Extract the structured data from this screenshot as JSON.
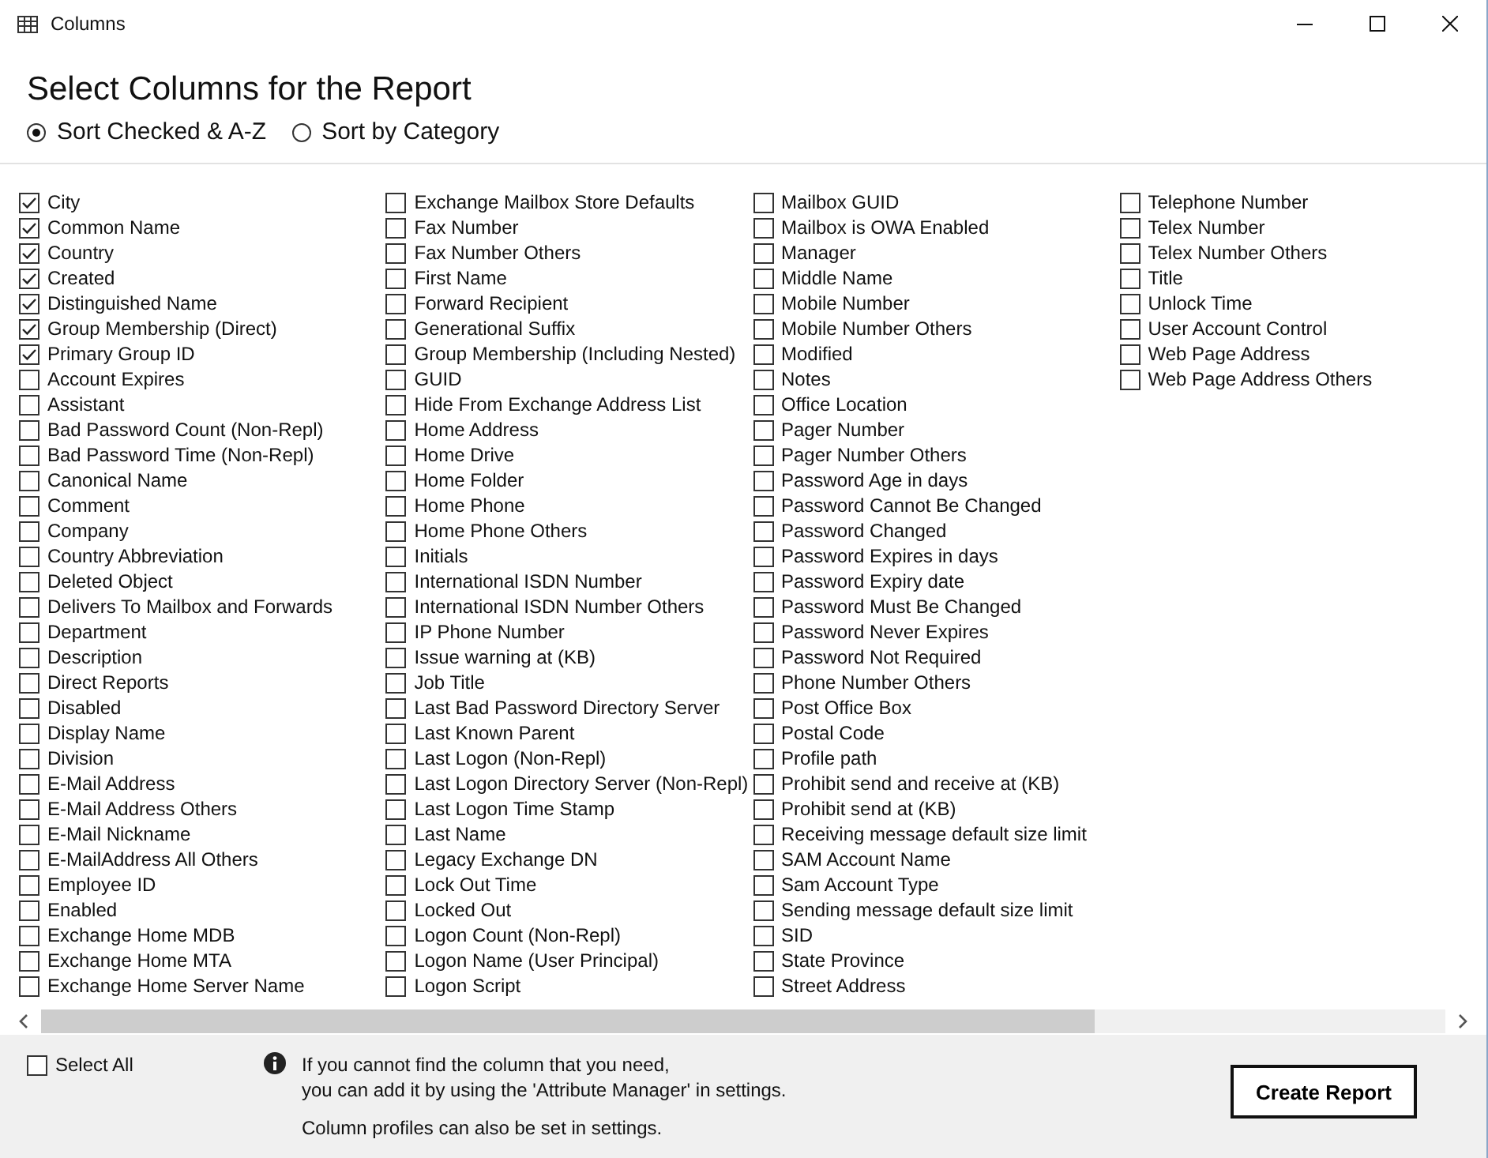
{
  "window": {
    "title": "Columns"
  },
  "heading": "Select Columns for the Report",
  "sort_options": [
    {
      "label": "Sort Checked & A-Z",
      "selected": true
    },
    {
      "label": "Sort by Category",
      "selected": false
    }
  ],
  "columns": [
    [
      {
        "label": "City",
        "checked": true
      },
      {
        "label": "Common Name",
        "checked": true
      },
      {
        "label": "Country",
        "checked": true
      },
      {
        "label": "Created",
        "checked": true
      },
      {
        "label": "Distinguished Name",
        "checked": true
      },
      {
        "label": "Group Membership (Direct)",
        "checked": true
      },
      {
        "label": "Primary Group ID",
        "checked": true
      },
      {
        "label": "Account Expires",
        "checked": false
      },
      {
        "label": "Assistant",
        "checked": false
      },
      {
        "label": "Bad Password Count (Non-Repl)",
        "checked": false
      },
      {
        "label": "Bad Password Time (Non-Repl)",
        "checked": false
      },
      {
        "label": "Canonical Name",
        "checked": false
      },
      {
        "label": "Comment",
        "checked": false
      },
      {
        "label": "Company",
        "checked": false
      },
      {
        "label": "Country Abbreviation",
        "checked": false
      },
      {
        "label": "Deleted Object",
        "checked": false
      },
      {
        "label": "Delivers To Mailbox and Forwards",
        "checked": false
      },
      {
        "label": "Department",
        "checked": false
      },
      {
        "label": "Description",
        "checked": false
      },
      {
        "label": "Direct Reports",
        "checked": false
      },
      {
        "label": "Disabled",
        "checked": false
      },
      {
        "label": "Display Name",
        "checked": false
      },
      {
        "label": "Division",
        "checked": false
      },
      {
        "label": "E-Mail Address",
        "checked": false
      },
      {
        "label": "E-Mail Address Others",
        "checked": false
      },
      {
        "label": "E-Mail Nickname",
        "checked": false
      },
      {
        "label": "E-MailAddress All Others",
        "checked": false
      },
      {
        "label": "Employee ID",
        "checked": false
      },
      {
        "label": "Enabled",
        "checked": false
      },
      {
        "label": "Exchange Home MDB",
        "checked": false
      },
      {
        "label": "Exchange Home MTA",
        "checked": false
      },
      {
        "label": "Exchange Home Server Name",
        "checked": false
      }
    ],
    [
      {
        "label": "Exchange Mailbox Store Defaults",
        "checked": false
      },
      {
        "label": "Fax Number",
        "checked": false
      },
      {
        "label": "Fax Number Others",
        "checked": false
      },
      {
        "label": "First Name",
        "checked": false
      },
      {
        "label": "Forward Recipient",
        "checked": false
      },
      {
        "label": "Generational Suffix",
        "checked": false
      },
      {
        "label": "Group Membership (Including Nested)",
        "checked": false
      },
      {
        "label": "GUID",
        "checked": false
      },
      {
        "label": "Hide From Exchange Address List",
        "checked": false
      },
      {
        "label": "Home Address",
        "checked": false
      },
      {
        "label": "Home Drive",
        "checked": false
      },
      {
        "label": "Home Folder",
        "checked": false
      },
      {
        "label": "Home Phone",
        "checked": false
      },
      {
        "label": "Home Phone Others",
        "checked": false
      },
      {
        "label": "Initials",
        "checked": false
      },
      {
        "label": "International ISDN Number",
        "checked": false
      },
      {
        "label": "International ISDN Number Others",
        "checked": false
      },
      {
        "label": "IP Phone Number",
        "checked": false
      },
      {
        "label": "Issue warning at (KB)",
        "checked": false
      },
      {
        "label": "Job Title",
        "checked": false
      },
      {
        "label": "Last Bad Password Directory Server",
        "checked": false
      },
      {
        "label": "Last Known Parent",
        "checked": false
      },
      {
        "label": "Last Logon (Non-Repl)",
        "checked": false
      },
      {
        "label": "Last Logon Directory Server (Non-Repl)",
        "checked": false
      },
      {
        "label": "Last Logon Time Stamp",
        "checked": false
      },
      {
        "label": "Last Name",
        "checked": false
      },
      {
        "label": "Legacy Exchange DN",
        "checked": false
      },
      {
        "label": "Lock Out Time",
        "checked": false
      },
      {
        "label": "Locked Out",
        "checked": false
      },
      {
        "label": "Logon Count (Non-Repl)",
        "checked": false
      },
      {
        "label": "Logon Name (User Principal)",
        "checked": false
      },
      {
        "label": "Logon Script",
        "checked": false
      }
    ],
    [
      {
        "label": "Mailbox GUID",
        "checked": false
      },
      {
        "label": "Mailbox is OWA Enabled",
        "checked": false
      },
      {
        "label": "Manager",
        "checked": false
      },
      {
        "label": "Middle Name",
        "checked": false
      },
      {
        "label": "Mobile Number",
        "checked": false
      },
      {
        "label": "Mobile Number Others",
        "checked": false
      },
      {
        "label": "Modified",
        "checked": false
      },
      {
        "label": "Notes",
        "checked": false
      },
      {
        "label": "Office Location",
        "checked": false
      },
      {
        "label": "Pager Number",
        "checked": false
      },
      {
        "label": "Pager Number Others",
        "checked": false
      },
      {
        "label": "Password Age in days",
        "checked": false
      },
      {
        "label": "Password Cannot Be Changed",
        "checked": false
      },
      {
        "label": "Password Changed",
        "checked": false
      },
      {
        "label": "Password Expires in days",
        "checked": false
      },
      {
        "label": "Password Expiry date",
        "checked": false
      },
      {
        "label": "Password Must Be Changed",
        "checked": false
      },
      {
        "label": "Password Never Expires",
        "checked": false
      },
      {
        "label": "Password Not Required",
        "checked": false
      },
      {
        "label": "Phone Number Others",
        "checked": false
      },
      {
        "label": "Post Office Box",
        "checked": false
      },
      {
        "label": "Postal Code",
        "checked": false
      },
      {
        "label": "Profile path",
        "checked": false
      },
      {
        "label": "Prohibit send and receive at (KB)",
        "checked": false
      },
      {
        "label": "Prohibit send at (KB)",
        "checked": false
      },
      {
        "label": "Receiving message default size limit",
        "checked": false
      },
      {
        "label": "SAM Account Name",
        "checked": false
      },
      {
        "label": "Sam Account Type",
        "checked": false
      },
      {
        "label": "Sending message default size limit",
        "checked": false
      },
      {
        "label": "SID",
        "checked": false
      },
      {
        "label": "State Province",
        "checked": false
      },
      {
        "label": "Street Address",
        "checked": false
      }
    ],
    [
      {
        "label": "Telephone Number",
        "checked": false
      },
      {
        "label": "Telex Number",
        "checked": false
      },
      {
        "label": "Telex Number Others",
        "checked": false
      },
      {
        "label": "Title",
        "checked": false
      },
      {
        "label": "Unlock Time",
        "checked": false
      },
      {
        "label": "User Account Control",
        "checked": false
      },
      {
        "label": "Web Page Address",
        "checked": false
      },
      {
        "label": "Web Page Address Others",
        "checked": false
      }
    ]
  ],
  "footer": {
    "select_all": {
      "label": "Select All",
      "checked": false
    },
    "info_lines": [
      "If you cannot find the column that you need,",
      "you can add it by using the 'Attribute Manager' in settings."
    ],
    "profile_note": "Column profiles can also be set in settings.",
    "button": "Create Report"
  }
}
